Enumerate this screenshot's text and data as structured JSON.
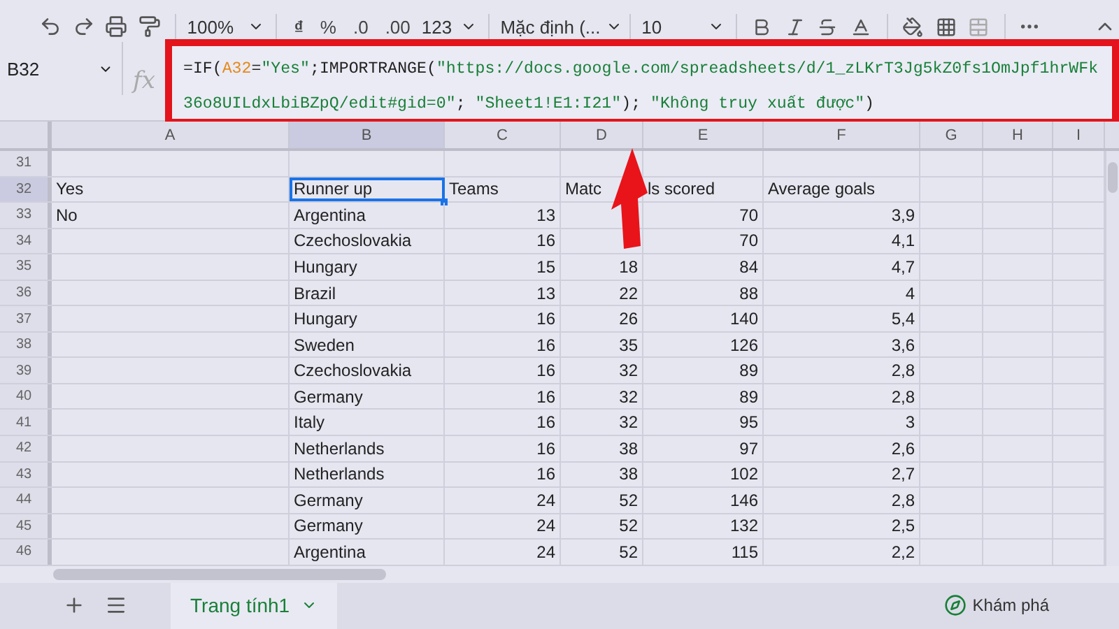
{
  "toolbar": {
    "zoom": "100%",
    "buttons": [
      "₫",
      "%",
      ".0",
      ".00"
    ],
    "number_format": "123",
    "font": "Mặc định (...",
    "font_size": "10"
  },
  "name_box": "B32",
  "formula_label": "fx",
  "formula": [
    {
      "kind": "plain",
      "text": "=IF("
    },
    {
      "kind": "reference",
      "text": "A32"
    },
    {
      "kind": "plain",
      "text": "="
    },
    {
      "kind": "string",
      "text": "\"Yes\""
    },
    {
      "kind": "plain",
      "text": ";IMPORTRANGE("
    },
    {
      "kind": "string",
      "text": "\"https://docs.google.com/spreadsheets/d/1_zLKrT3Jg5kZ0fs1OmJpf1hrWFk36o8UILdxLbiBZpQ/edit#gid=0\""
    },
    {
      "kind": "plain",
      "text": "; "
    },
    {
      "kind": "string",
      "text": "\"Sheet1!E1:I21\""
    },
    {
      "kind": "plain",
      "text": "); "
    },
    {
      "kind": "string",
      "text": "\"Không truy xuất được\""
    },
    {
      "kind": "plain",
      "text": ")"
    }
  ],
  "columns": [
    {
      "label": "A",
      "selected": false
    },
    {
      "label": "B",
      "selected": true
    },
    {
      "label": "C",
      "selected": false
    },
    {
      "label": "D",
      "selected": false
    },
    {
      "label": "E",
      "selected": false
    },
    {
      "label": "F",
      "selected": false
    },
    {
      "label": "G",
      "selected": false
    },
    {
      "label": "H",
      "selected": false
    },
    {
      "label": "I",
      "selected": false
    }
  ],
  "rows": [
    {
      "number": "31",
      "selected": false,
      "kind": "header",
      "cells": [
        null,
        null,
        null,
        null,
        null,
        null
      ]
    },
    {
      "number": "32",
      "selected": true,
      "kind": "header",
      "cells": [
        "Yes",
        "Runner up",
        "Teams",
        "Matc",
        "ls scored",
        "Average goals"
      ]
    },
    {
      "number": "33",
      "selected": false,
      "kind": "data",
      "cells": [
        "No",
        "Argentina",
        "13",
        null,
        "70",
        "3,9"
      ]
    },
    {
      "number": "34",
      "selected": false,
      "kind": "data",
      "cells": [
        null,
        "Czechoslovakia",
        "16",
        null,
        "70",
        "4,1"
      ]
    },
    {
      "number": "35",
      "selected": false,
      "kind": "data",
      "cells": [
        null,
        "Hungary",
        "15",
        "18",
        "84",
        "4,7"
      ]
    },
    {
      "number": "36",
      "selected": false,
      "kind": "data",
      "cells": [
        null,
        "Brazil",
        "13",
        "22",
        "88",
        "4"
      ]
    },
    {
      "number": "37",
      "selected": false,
      "kind": "data",
      "cells": [
        null,
        "Hungary",
        "16",
        "26",
        "140",
        "5,4"
      ]
    },
    {
      "number": "38",
      "selected": false,
      "kind": "data",
      "cells": [
        null,
        "Sweden",
        "16",
        "35",
        "126",
        "3,6"
      ]
    },
    {
      "number": "39",
      "selected": false,
      "kind": "data",
      "cells": [
        null,
        "Czechoslovakia",
        "16",
        "32",
        "89",
        "2,8"
      ]
    },
    {
      "number": "40",
      "selected": false,
      "kind": "data",
      "cells": [
        null,
        "Germany",
        "16",
        "32",
        "89",
        "2,8"
      ]
    },
    {
      "number": "41",
      "selected": false,
      "kind": "data",
      "cells": [
        null,
        "Italy",
        "16",
        "32",
        "95",
        "3"
      ]
    },
    {
      "number": "42",
      "selected": false,
      "kind": "data",
      "cells": [
        null,
        "Netherlands",
        "16",
        "38",
        "97",
        "2,6"
      ]
    },
    {
      "number": "43",
      "selected": false,
      "kind": "data",
      "cells": [
        null,
        "Netherlands",
        "16",
        "38",
        "102",
        "2,7"
      ]
    },
    {
      "number": "44",
      "selected": false,
      "kind": "data",
      "cells": [
        null,
        "Germany",
        "24",
        "52",
        "146",
        "2,8"
      ]
    },
    {
      "number": "45",
      "selected": false,
      "kind": "data",
      "cells": [
        null,
        "Germany",
        "24",
        "52",
        "132",
        "2,5"
      ]
    },
    {
      "number": "46",
      "selected": false,
      "kind": "data",
      "cells": [
        null,
        "Argentina",
        "24",
        "52",
        "115",
        "2,2"
      ]
    }
  ],
  "sheet_tabs": [
    {
      "label": "Trang tính1",
      "selected": true
    }
  ],
  "explore": "Khám phá"
}
